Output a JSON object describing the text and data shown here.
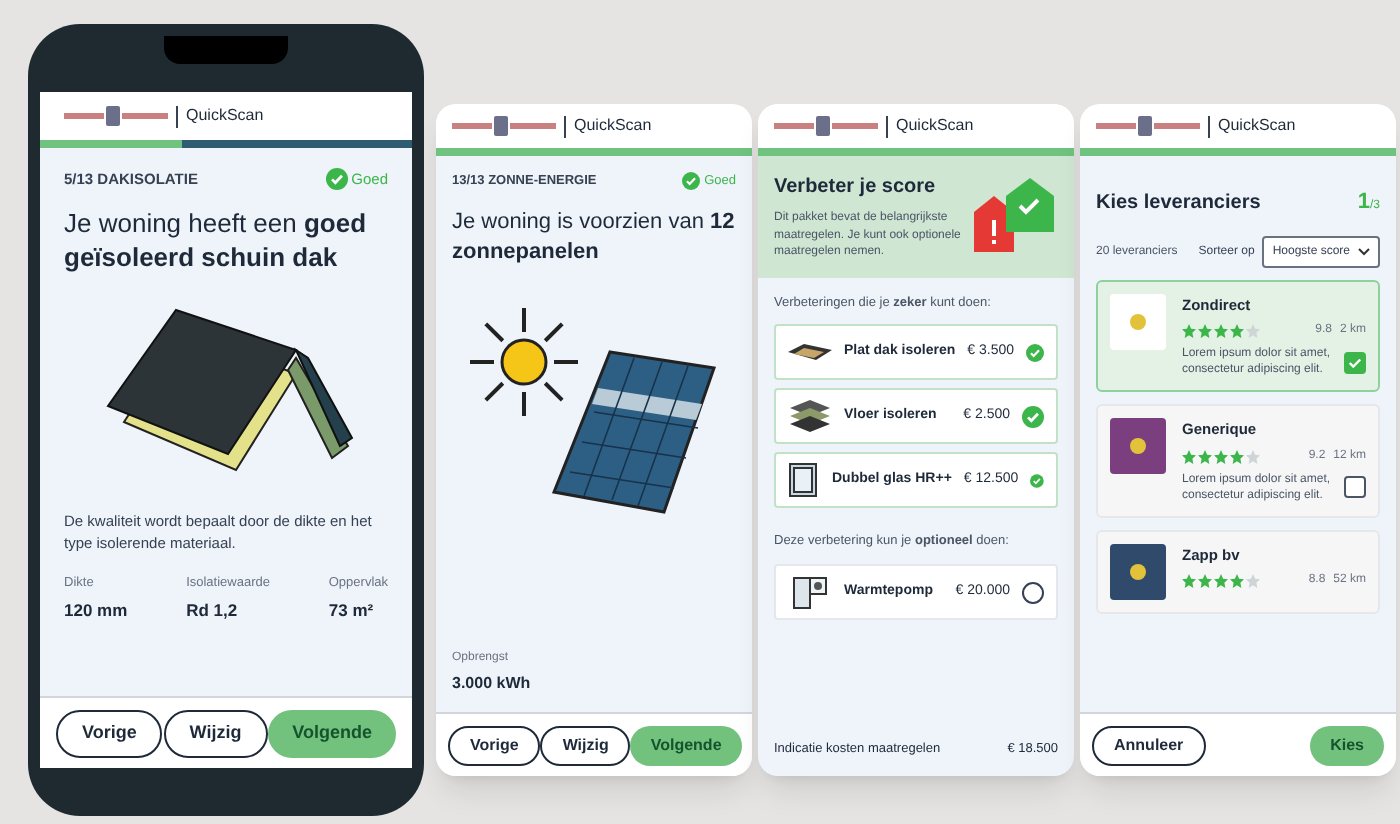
{
  "phone": {
    "app_name": "QuickScan",
    "progress": {
      "level": 0.38
    },
    "step": "5/13",
    "topic": "DAKISOLATIE",
    "status": "Goed",
    "title": "Je woning heeft een **goed geïsoleerd schuin dak**",
    "description": "De kwaliteit wordt bepaalt door de dikte en het type isolerende materiaal.",
    "stats": [
      {
        "label": "Dikte",
        "value": "120 mm"
      },
      {
        "label": "Isolatiewaarde",
        "value": "Rd 1,2"
      },
      {
        "label": "Oppervlak",
        "value": "73 m²"
      }
    ],
    "buttons": [
      {
        "label": "Vorige",
        "kind": "outline"
      },
      {
        "label": "Wijzig",
        "kind": "outline"
      },
      {
        "label": "Volgende",
        "kind": "primary"
      }
    ]
  },
  "solar": {
    "app_name": "QuickScan",
    "progress": {
      "level": 1
    },
    "step": "13/13",
    "topic": "ZONNE-ENERGIE",
    "status": "Goed",
    "title": "Je woning is voorzien van **12 zonnepanelen**",
    "stats": [
      {
        "label": "Opbrengst",
        "value": "3.000 kWh"
      }
    ],
    "buttons": [
      {
        "label": "Vorige",
        "kind": "outline"
      },
      {
        "label": "Wijzig",
        "kind": "outline"
      },
      {
        "label": "Volgende",
        "kind": "primary"
      }
    ]
  },
  "improve": {
    "app_name": "QuickScan",
    "progress": {
      "level": 1
    },
    "title": "Verbeter je score",
    "intro": "Dit pakket bevat de belangrijkste maatregelen. Je kunt ook optionele maatregelen nemen.",
    "sure_label": "Verbeteringen die je **zeker** kunt doen:",
    "sure": [
      {
        "name": "Plat dak isoleren",
        "price": "€ 3.500",
        "checked": true
      },
      {
        "name": "Vloer isoleren",
        "price": "€ 2.500",
        "checked": true
      },
      {
        "name": "Dubbel glas HR++",
        "price": "€ 12.500",
        "checked": true
      }
    ],
    "optional_label": "Deze verbetering kun je **optioneel** doen:",
    "optional": [
      {
        "name": "Warmtepomp",
        "price": "€ 20.000",
        "checked": false
      }
    ],
    "total_label": "Indicatie kosten maatregelen",
    "total": "€ 18.500"
  },
  "suppliers": {
    "app_name": "QuickScan",
    "progress": {
      "level": 1
    },
    "title": "Kies leveranciers",
    "page_current": "1",
    "page_total": "/3",
    "count": "20 leveranciers",
    "sort_label": "Sorteer op",
    "sort_value": "Hoogste score",
    "items": [
      {
        "name": "Zondirect",
        "stars": 4,
        "rating": "9.8",
        "distance": "2 km",
        "description": "Lorem ipsum dolor sit amet, consectetur adipiscing elit.",
        "selected": true,
        "color": "#ffffff"
      },
      {
        "name": "Generique",
        "stars": 4,
        "rating": "9.2",
        "distance": "12 km",
        "description": "Lorem ipsum dolor sit amet, consectetur adipiscing elit.",
        "selected": false,
        "color": "#7b3f7f"
      },
      {
        "name": "Zapp bv",
        "stars": 4,
        "rating": "8.8",
        "distance": "52 km",
        "selected": false,
        "color": "#2f4a6b"
      }
    ],
    "buttons": [
      {
        "label": "Annuleer",
        "kind": "outline"
      },
      {
        "label": "Kies",
        "kind": "primary"
      }
    ]
  }
}
